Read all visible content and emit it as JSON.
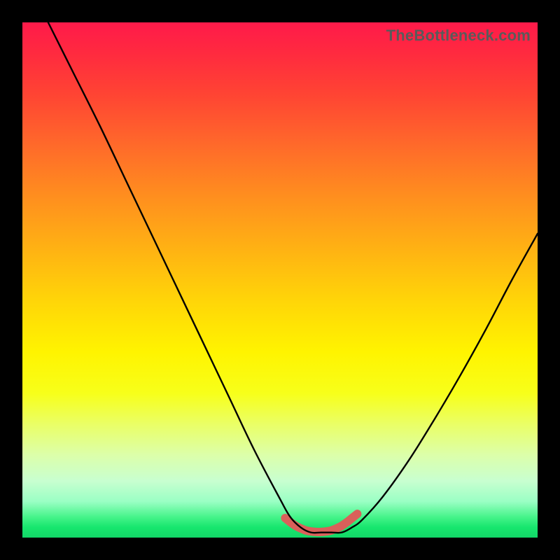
{
  "watermark": {
    "text": "TheBottleneck.com"
  },
  "chart_data": {
    "type": "line",
    "title": "",
    "xlabel": "",
    "ylabel": "",
    "xlim": [
      0,
      100
    ],
    "ylim": [
      0,
      100
    ],
    "grid": false,
    "legend": false,
    "series": [
      {
        "name": "bottleneck-curve",
        "color": "#000000",
        "x": [
          5,
          10,
          15,
          20,
          25,
          30,
          35,
          40,
          45,
          50,
          52,
          54,
          56,
          58,
          60,
          62,
          64,
          66,
          70,
          75,
          80,
          85,
          90,
          95,
          100
        ],
        "y": [
          100,
          90,
          80,
          69.5,
          59,
          48.5,
          38,
          27.5,
          17,
          7.5,
          4,
          2,
          1,
          1,
          1,
          1,
          2,
          3.5,
          8,
          15,
          23,
          31.5,
          40.5,
          50,
          59
        ]
      },
      {
        "name": "optimal-zone-marker",
        "color": "#d9605a",
        "x": [
          51,
          52,
          53,
          54,
          55,
          56,
          57,
          58,
          59,
          60,
          61,
          62,
          63,
          64,
          65
        ],
        "y": [
          3.8,
          3.0,
          2.3,
          1.8,
          1.4,
          1.2,
          1.1,
          1.1,
          1.2,
          1.4,
          1.8,
          2.3,
          3.0,
          3.8,
          4.6
        ]
      }
    ],
    "background_gradient": {
      "orientation": "vertical",
      "stops": [
        {
          "pos": 0.0,
          "color": "#ff1a4a"
        },
        {
          "pos": 0.5,
          "color": "#ffd508"
        },
        {
          "pos": 0.72,
          "color": "#f7ff1a"
        },
        {
          "pos": 1.0,
          "color": "#12d767"
        }
      ]
    }
  }
}
